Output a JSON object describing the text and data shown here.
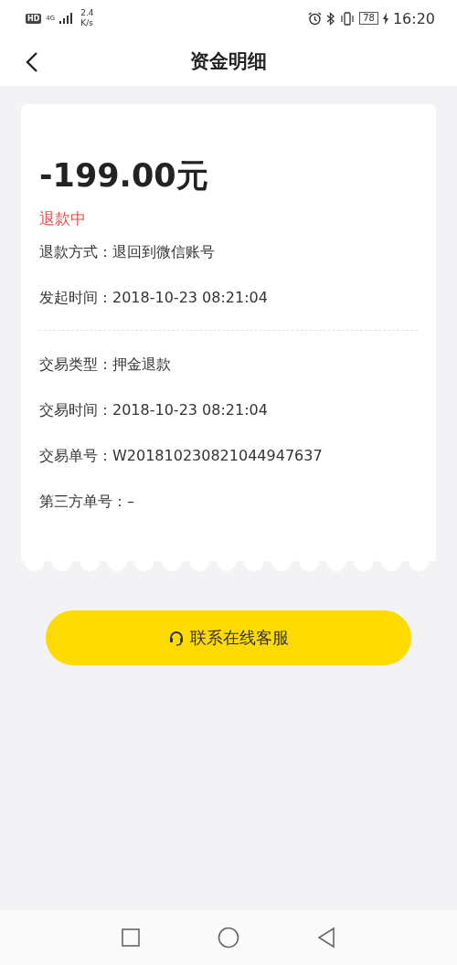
{
  "status_bar": {
    "hd": "HD",
    "network": "4G",
    "speed": "2.4",
    "speed_unit": "K/s",
    "battery": "78",
    "time": "16:20"
  },
  "header": {
    "title": "资金明细"
  },
  "amount": "-199.00元",
  "status": "退款中",
  "detail_groups": [
    [
      {
        "label": "退款方式：",
        "value": "退回到微信账号"
      },
      {
        "label": "发起时间：",
        "value": "2018-10-23 08:21:04"
      }
    ],
    [
      {
        "label": "交易类型：",
        "value": "押金退款"
      },
      {
        "label": "交易时间：",
        "value": "2018-10-23 08:21:04"
      },
      {
        "label": "交易单号：",
        "value": "W201810230821044947637"
      },
      {
        "label": "第三方单号：",
        "value": "–"
      }
    ]
  ],
  "contact_button": "联系在线客服"
}
